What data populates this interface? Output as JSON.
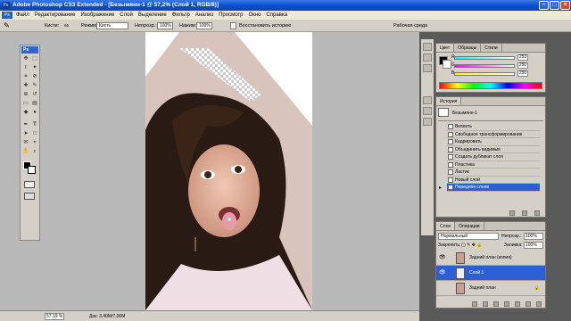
{
  "window": {
    "title": "Adobe Photoshop CS3 Extended - [Безымянн-1 @ 57,2% (Слой 1, RGB/8)]",
    "app_badge": "Ps"
  },
  "menu": {
    "logo": "Ps",
    "items": [
      "Файл",
      "Редактирование",
      "Изображение",
      "Слой",
      "Выделение",
      "Фильтр",
      "Анализ",
      "Просмотр",
      "Окно",
      "Справка"
    ]
  },
  "options": {
    "brush_label": "Кисти:",
    "brush_size": "65",
    "mode_label": "Режим:",
    "mode_value": "Кисть",
    "opacity_label": "Непрозр.:",
    "opacity_value": "100%",
    "pressure_label": "Нажим:",
    "pressure_value": "100%",
    "restore_label": "Восстановить историю",
    "workspace_label": "Рабочая среда"
  },
  "toolbox": {
    "badge": "Ps"
  },
  "status": {
    "zoom": "57,19 %",
    "doc": "Док: 3,40M/7,00M"
  },
  "color_panel": {
    "tabs": [
      "Цвет",
      "Образцы",
      "Стили"
    ],
    "channels": [
      {
        "label": "R",
        "value": "253"
      },
      {
        "label": "G",
        "value": "250"
      },
      {
        "label": "B",
        "value": "250"
      }
    ],
    "foreground_color": "#000000",
    "background_color": "#fdfafa"
  },
  "history_panel": {
    "tabs": [
      "История"
    ],
    "snapshot": "Безымянн-1",
    "items": [
      "Вклеить",
      "Свободное трансформирование",
      "Кадрировать",
      "Объединить видимые",
      "Создать дубликат слоя",
      "Пластика",
      "Ластик",
      "Новый слой",
      "Передняя слоев"
    ],
    "selected_index": 8
  },
  "layers_panel": {
    "tabs": [
      "Слои",
      "Операции"
    ],
    "blend_mode": "Нормальный",
    "opacity_label": "Непрозр.:",
    "opacity_value": "100%",
    "lock_label": "Закрепить:",
    "fill_label": "Заливка:",
    "fill_value": "100%",
    "layers": [
      {
        "name": "Задний план (копия)",
        "visible": true,
        "selected": false
      },
      {
        "name": "Слой 1",
        "visible": true,
        "selected": true
      },
      {
        "name": "Задний план",
        "visible": false,
        "selected": false
      }
    ]
  },
  "colors": {
    "accent": "#2d5fd4",
    "titlebar": "#0a4fd0"
  }
}
